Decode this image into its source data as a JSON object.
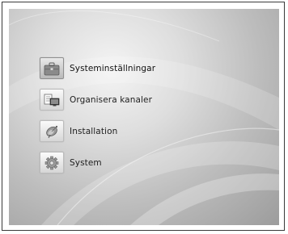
{
  "menu": {
    "items": [
      {
        "label": "Systeminställningar",
        "icon": "briefcase-icon",
        "selected": true
      },
      {
        "label": "Organisera kanaler",
        "icon": "channel-list-icon",
        "selected": false
      },
      {
        "label": "Installation",
        "icon": "satellite-dish-icon",
        "selected": false
      },
      {
        "label": "System",
        "icon": "gear-icon",
        "selected": false
      }
    ]
  },
  "colors": {
    "background_light": "#f4f4f4",
    "background_dark": "#9c9c9c",
    "text": "#1e1e1e",
    "frame": "#3a3a3a"
  }
}
